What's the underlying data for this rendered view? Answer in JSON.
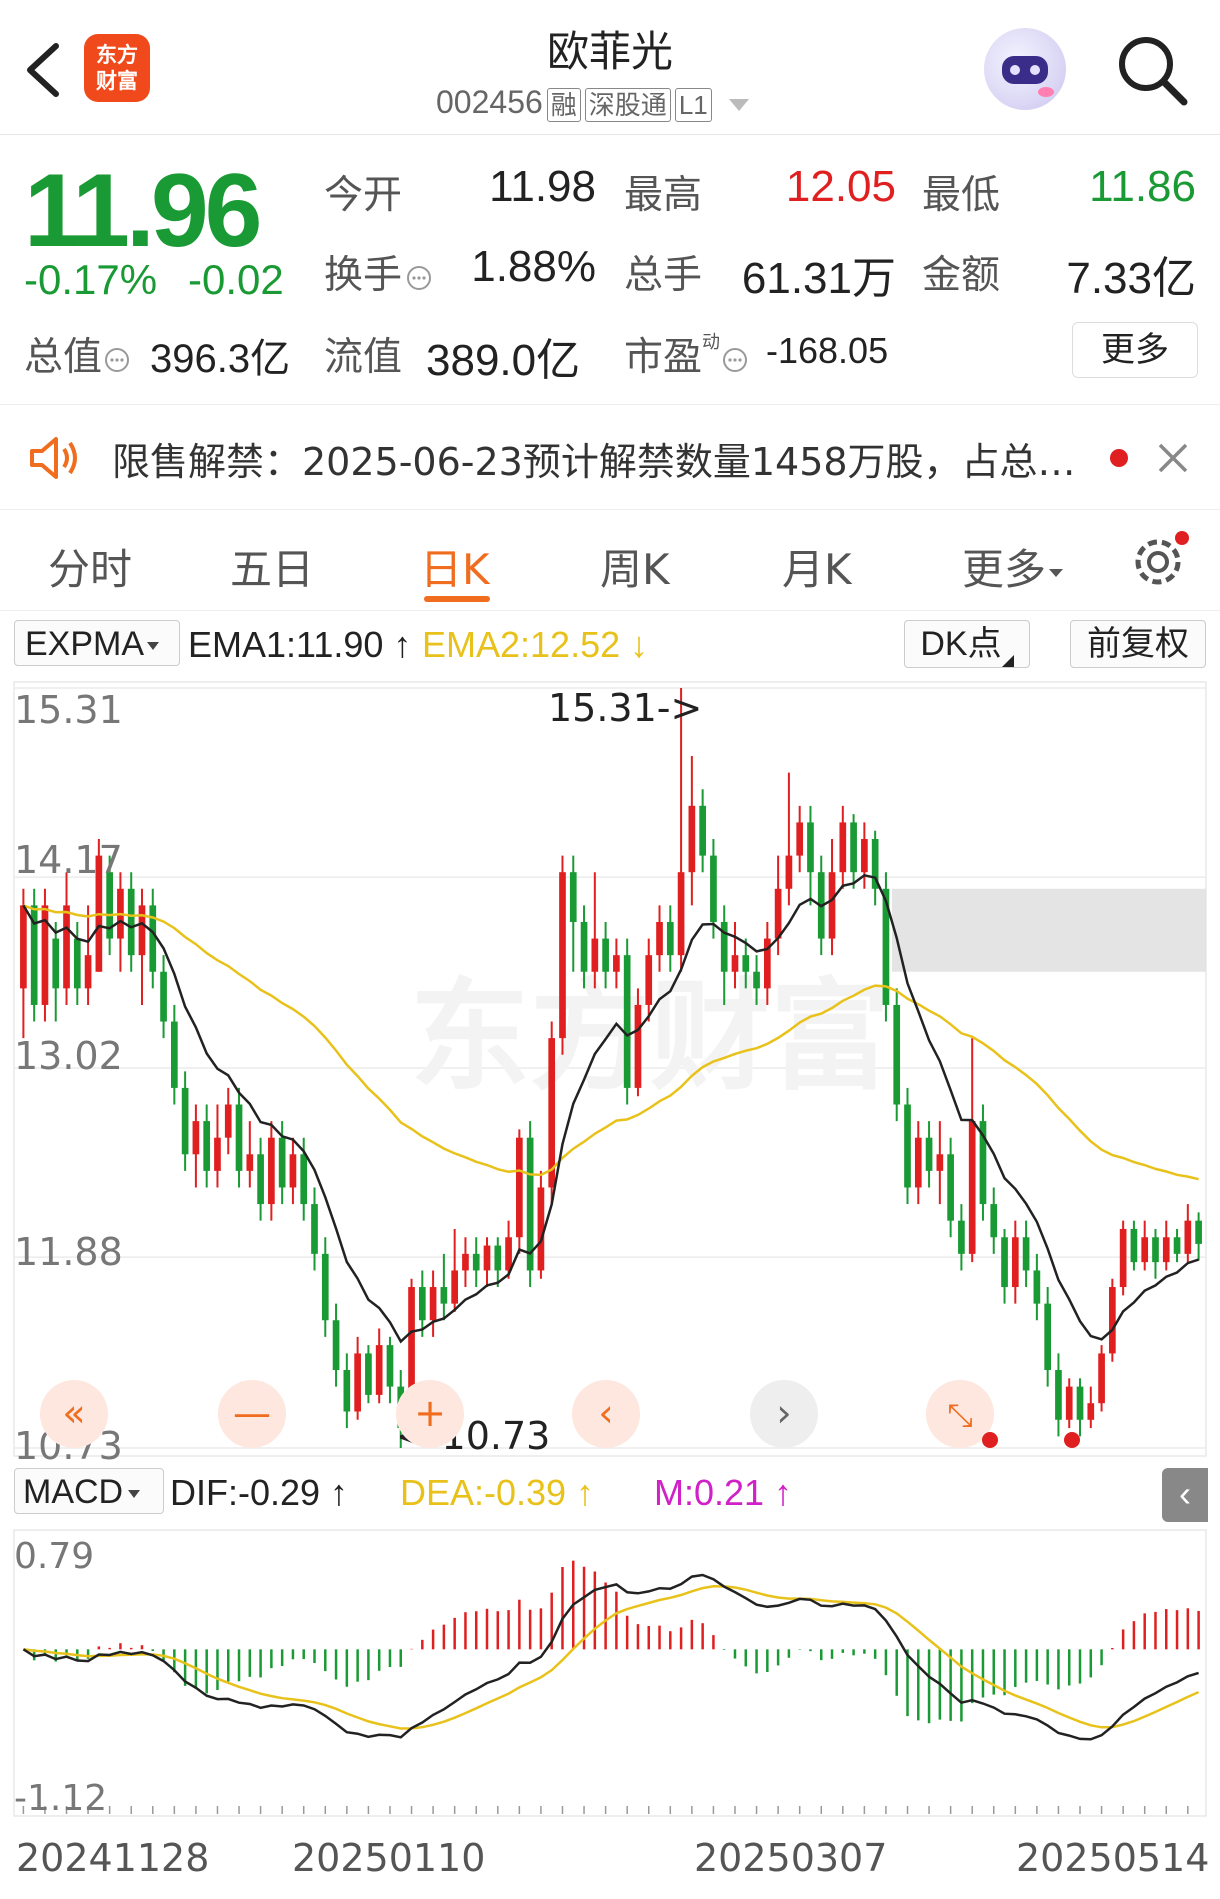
{
  "header": {
    "back_icon": "chevron-left-icon",
    "logo_line1": "东方",
    "logo_line2": "财富",
    "title": "欧菲光",
    "code": "002456",
    "tags": [
      "融",
      "深股通",
      "L1"
    ],
    "search_icon": "search-icon"
  },
  "quote": {
    "price": "11.96",
    "change_pct": "-0.17%",
    "change": "-0.02",
    "open_label": "今开",
    "open": "11.98",
    "high_label": "最高",
    "high": "12.05",
    "low_label": "最低",
    "low": "11.86",
    "turnover_label": "换手",
    "turnover": "1.88%",
    "volume_label": "总手",
    "volume": "61.31万",
    "amount_label": "金额",
    "amount": "7.33亿",
    "mcap_label": "总值",
    "mcap": "396.3亿",
    "float_label": "流值",
    "float": "389.0亿",
    "pe_label": "市盈",
    "pe_sup": "动",
    "pe": "-168.05",
    "more_label": "更多",
    "colors": {
      "down": "#1a9a34",
      "up": "#e02020"
    }
  },
  "notice": {
    "text": "限售解禁：2025-06-23预计解禁数量1458万股，占总…"
  },
  "tabs": {
    "items": [
      "分时",
      "五日",
      "日K",
      "周K",
      "月K",
      "更多"
    ],
    "active": "日K"
  },
  "kline_bar": {
    "indicator": "EXPMA",
    "ema1": "EMA1:11.90",
    "ema2": "EMA2:12.52",
    "dk": "DK点",
    "adj": "前复权"
  },
  "macd_bar": {
    "indicator": "MACD",
    "dif": "DIF:-0.29",
    "dea": "DEA:-0.39",
    "m": "M:0.21"
  },
  "watermark": "东方财富",
  "chart_data": [
    {
      "type": "candlestick",
      "y_ticks": [
        "15.31",
        "14.17",
        "13.02",
        "11.88",
        "10.73"
      ],
      "ylim": [
        10.73,
        15.31
      ],
      "max_label": "15.31->",
      "min_label": "<-10.73",
      "series": [
        {
          "name": "EMA1:11.90",
          "color": "#222222"
        },
        {
          "name": "EMA2:12.52",
          "color": "#e8c21a"
        }
      ],
      "candles": [
        [
          13.5,
          14.0,
          14.1,
          13.2
        ],
        [
          14.0,
          13.4,
          14.1,
          13.3
        ],
        [
          13.4,
          14.0,
          14.1,
          13.3
        ],
        [
          13.8,
          13.5,
          13.9,
          13.3
        ],
        [
          13.5,
          14.0,
          14.2,
          13.4
        ],
        [
          13.8,
          13.5,
          13.9,
          13.4
        ],
        [
          13.5,
          13.7,
          14.0,
          13.4
        ],
        [
          13.6,
          14.3,
          14.4,
          13.6
        ],
        [
          14.2,
          13.8,
          14.3,
          13.7
        ],
        [
          13.8,
          14.1,
          14.2,
          13.6
        ],
        [
          14.1,
          13.7,
          14.2,
          13.6
        ],
        [
          13.7,
          14.0,
          14.1,
          13.4
        ],
        [
          14.0,
          13.6,
          14.1,
          13.5
        ],
        [
          13.6,
          13.3,
          13.7,
          13.2
        ],
        [
          13.3,
          12.9,
          13.4,
          12.8
        ],
        [
          12.9,
          12.5,
          13.0,
          12.4
        ],
        [
          12.5,
          12.7,
          12.8,
          12.3
        ],
        [
          12.7,
          12.4,
          12.8,
          12.3
        ],
        [
          12.4,
          12.6,
          12.8,
          12.3
        ],
        [
          12.6,
          12.8,
          12.9,
          12.5
        ],
        [
          12.8,
          12.4,
          12.9,
          12.3
        ],
        [
          12.4,
          12.5,
          12.7,
          12.3
        ],
        [
          12.5,
          12.2,
          12.6,
          12.1
        ],
        [
          12.2,
          12.6,
          12.7,
          12.1
        ],
        [
          12.6,
          12.3,
          12.7,
          12.2
        ],
        [
          12.3,
          12.5,
          12.6,
          12.2
        ],
        [
          12.5,
          12.2,
          12.6,
          12.1
        ],
        [
          12.2,
          11.9,
          12.3,
          11.8
        ],
        [
          11.9,
          11.5,
          12.0,
          11.4
        ],
        [
          11.5,
          11.2,
          11.6,
          11.1
        ],
        [
          11.2,
          10.95,
          11.3,
          10.85
        ],
        [
          10.95,
          11.3,
          11.4,
          10.9
        ],
        [
          11.3,
          11.05,
          11.35,
          11.0
        ],
        [
          11.05,
          11.35,
          11.45,
          11.0
        ],
        [
          11.35,
          11.1,
          11.4,
          11.0
        ],
        [
          11.1,
          10.85,
          11.2,
          10.73
        ],
        [
          10.85,
          11.7,
          11.75,
          10.8
        ],
        [
          11.7,
          11.5,
          11.8,
          11.4
        ],
        [
          11.5,
          11.7,
          11.8,
          11.4
        ],
        [
          11.7,
          11.6,
          11.9,
          11.5
        ],
        [
          11.6,
          11.8,
          12.05,
          11.55
        ],
        [
          11.8,
          11.9,
          12.0,
          11.7
        ],
        [
          11.9,
          11.8,
          12.0,
          11.7
        ],
        [
          11.8,
          11.95,
          12.0,
          11.7
        ],
        [
          11.95,
          11.8,
          12.0,
          11.7
        ],
        [
          11.8,
          12.0,
          12.1,
          11.75
        ],
        [
          12.0,
          12.6,
          12.65,
          11.9
        ],
        [
          12.6,
          11.8,
          12.7,
          11.7
        ],
        [
          11.8,
          12.3,
          12.4,
          11.75
        ],
        [
          12.3,
          13.2,
          13.3,
          12.2
        ],
        [
          13.2,
          14.2,
          14.3,
          13.1
        ],
        [
          14.2,
          13.9,
          14.3,
          13.6
        ],
        [
          13.9,
          13.6,
          14.0,
          13.5
        ],
        [
          13.6,
          13.8,
          14.2,
          13.5
        ],
        [
          13.8,
          13.6,
          13.9,
          13.5
        ],
        [
          13.6,
          13.7,
          13.8,
          13.5
        ],
        [
          13.7,
          12.9,
          13.8,
          12.8
        ],
        [
          12.9,
          13.4,
          13.5,
          12.85
        ],
        [
          13.4,
          13.7,
          13.8,
          13.3
        ],
        [
          13.7,
          13.9,
          14.0,
          13.6
        ],
        [
          13.9,
          13.7,
          14.0,
          13.6
        ],
        [
          13.7,
          14.2,
          15.31,
          13.6
        ],
        [
          14.2,
          14.6,
          14.9,
          14.0
        ],
        [
          14.6,
          14.3,
          14.7,
          14.2
        ],
        [
          14.3,
          13.9,
          14.4,
          13.8
        ],
        [
          13.9,
          13.6,
          14.0,
          13.4
        ],
        [
          13.6,
          13.7,
          13.9,
          13.5
        ],
        [
          13.7,
          13.6,
          13.8,
          13.5
        ],
        [
          13.6,
          13.5,
          13.7,
          13.4
        ],
        [
          13.5,
          13.8,
          13.9,
          13.4
        ],
        [
          13.8,
          14.1,
          14.3,
          13.7
        ],
        [
          14.1,
          14.3,
          14.8,
          14.0
        ],
        [
          14.3,
          14.5,
          14.6,
          14.2
        ],
        [
          14.5,
          14.2,
          14.6,
          14.0
        ],
        [
          14.2,
          13.8,
          14.3,
          13.7
        ],
        [
          13.8,
          14.2,
          14.4,
          13.7
        ],
        [
          14.2,
          14.5,
          14.6,
          14.1
        ],
        [
          14.5,
          14.2,
          14.55,
          14.1
        ],
        [
          14.2,
          14.4,
          14.5,
          14.1
        ],
        [
          14.4,
          14.1,
          14.45,
          14.0
        ],
        [
          14.1,
          13.4,
          14.2,
          13.3
        ],
        [
          13.4,
          12.8,
          13.5,
          12.7
        ],
        [
          12.8,
          12.3,
          12.9,
          12.2
        ],
        [
          12.3,
          12.6,
          12.7,
          12.2
        ],
        [
          12.6,
          12.4,
          12.7,
          12.3
        ],
        [
          12.4,
          12.5,
          12.7,
          12.2
        ],
        [
          12.5,
          12.1,
          12.6,
          12.0
        ],
        [
          12.1,
          11.9,
          12.2,
          11.8
        ],
        [
          11.9,
          12.7,
          13.2,
          11.85
        ],
        [
          12.7,
          12.2,
          12.8,
          12.1
        ],
        [
          12.2,
          12.0,
          12.3,
          11.9
        ],
        [
          12.0,
          11.7,
          12.05,
          11.6
        ],
        [
          11.7,
          12.0,
          12.1,
          11.6
        ],
        [
          12.0,
          11.8,
          12.1,
          11.7
        ],
        [
          11.8,
          11.6,
          11.9,
          11.5
        ],
        [
          11.6,
          11.2,
          11.7,
          11.1
        ],
        [
          11.2,
          10.9,
          11.3,
          10.8
        ],
        [
          10.9,
          11.1,
          11.15,
          10.85
        ],
        [
          11.1,
          10.9,
          11.15,
          10.8
        ],
        [
          10.9,
          11.0,
          11.1,
          10.85
        ],
        [
          11.0,
          11.3,
          11.35,
          10.95
        ],
        [
          11.3,
          11.7,
          11.75,
          11.25
        ],
        [
          11.7,
          12.05,
          12.1,
          11.65
        ],
        [
          12.05,
          11.85,
          12.1,
          11.8
        ],
        [
          11.85,
          12.0,
          12.1,
          11.8
        ],
        [
          12.0,
          11.85,
          12.05,
          11.75
        ],
        [
          11.85,
          12.0,
          12.1,
          11.8
        ],
        [
          12.0,
          11.9,
          12.05,
          11.85
        ],
        [
          11.9,
          12.1,
          12.2,
          11.85
        ],
        [
          12.1,
          11.96,
          12.15,
          11.86
        ]
      ]
    },
    {
      "type": "macd",
      "y_ticks": [
        "0.79",
        "-1.12"
      ],
      "ylim": [
        -1.12,
        0.79
      ],
      "series": [
        {
          "name": "DIF:-0.29",
          "color": "#222222"
        },
        {
          "name": "DEA:-0.39",
          "color": "#e8c21a"
        },
        {
          "name": "M:0.21",
          "color": "#d020c8"
        }
      ],
      "x_ticks": [
        "20241128",
        "20250110",
        "20250307",
        "20250514"
      ]
    }
  ]
}
